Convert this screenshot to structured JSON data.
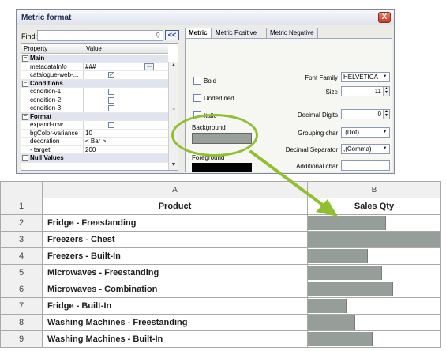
{
  "dialog": {
    "title": "Metric format",
    "close_glyph": "X",
    "find_label": "Find:",
    "find_value": "",
    "collapse_label": "<<",
    "grid_headers": {
      "property": "Property",
      "value": "Value"
    },
    "rows": [
      {
        "type": "cat",
        "name": "Main"
      },
      {
        "type": "prop",
        "name": "metadataInfo",
        "value": "###",
        "bold_value": true,
        "ellipsis": true
      },
      {
        "type": "prop",
        "name": "catalogue-web-...",
        "checkbox": "on"
      },
      {
        "type": "cat",
        "name": "Conditions"
      },
      {
        "type": "prop",
        "name": "condition-1",
        "checkbox": "off"
      },
      {
        "type": "prop",
        "name": "condition-2",
        "checkbox": "off"
      },
      {
        "type": "prop",
        "name": "condition-3",
        "checkbox": "off"
      },
      {
        "type": "cat",
        "name": "Format"
      },
      {
        "type": "prop",
        "name": "expand-row",
        "checkbox": "off"
      },
      {
        "type": "prop",
        "name": "bgColor-variance",
        "value": "10"
      },
      {
        "type": "prop",
        "name": "decoration",
        "value": "< Bar >"
      },
      {
        "type": "prop",
        "name": "- target",
        "value": "200"
      },
      {
        "type": "cat",
        "name": "Null Values"
      }
    ],
    "tabs": [
      "Metric",
      "Metric Positive",
      "Metric Negative"
    ],
    "active_tab": "Metric",
    "bold_label": "Bold",
    "underlined_label": "Underlined",
    "italic_label": "Italic",
    "background_label": "Background",
    "foreground_label": "Foreground",
    "background_color": "#999f9b",
    "foreground_color": "#000000",
    "font_family_label": "Font Family",
    "font_family_value": "HELVETICA",
    "size_label": "Size",
    "size_value": "11",
    "decimal_digits_label": "Decimal Digits",
    "decimal_digits_value": "0",
    "grouping_label": "Grouping char",
    "grouping_value": ".(Dot)",
    "decimal_sep_label": "Decimal Separator",
    "decimal_sep_value": ",(Comma)",
    "additional_label": "Additional char",
    "additional_value": ""
  },
  "sheet": {
    "col_a": "A",
    "col_b": "B",
    "header_row": {
      "num": "1",
      "product": "Product",
      "qty": "Sales Qty"
    },
    "rows": [
      {
        "num": "2",
        "product": "Fridge - Freestanding",
        "fill": 0.59
      },
      {
        "num": "3",
        "product": "Freezers - Chest",
        "fill": 1.0
      },
      {
        "num": "4",
        "product": "Freezers - Built-In",
        "fill": 0.45
      },
      {
        "num": "5",
        "product": "Microwaves - Freestanding",
        "fill": 0.56
      },
      {
        "num": "6",
        "product": "Microwaves - Combination",
        "fill": 0.64
      },
      {
        "num": "7",
        "product": "Fridge - Built-In",
        "fill": 0.29
      },
      {
        "num": "8",
        "product": "Washing Machines - Freestanding",
        "fill": 0.36
      },
      {
        "num": "9",
        "product": "Washing Machines - Built-In",
        "fill": 0.49
      }
    ],
    "bar_color": "#969e9a"
  },
  "annotation": {
    "ring_color": "#91bf32",
    "arrow_color": "#91bf32"
  }
}
